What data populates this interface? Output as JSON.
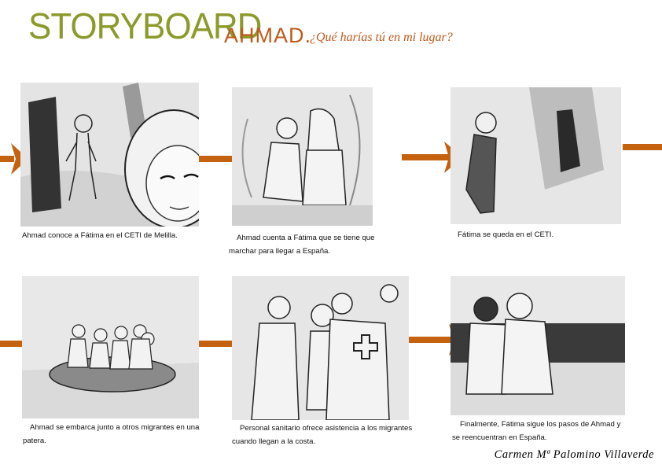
{
  "header": {
    "title": "STORYBOARD",
    "subtitle": "AHMAD.",
    "question": "¿Qué harías tú en mi lugar?"
  },
  "colors": {
    "title": "#8c9a2a",
    "accent": "#c05a1c",
    "arrow": "#c4620f"
  },
  "panels": [
    {
      "caption": "Ahmad conoce a Fátima en el CETI de Melilla."
    },
    {
      "caption": "Ahmad cuenta a Fátima que se tiene que marchar para llegar a España."
    },
    {
      "caption": "Fátima se queda en el CETI."
    },
    {
      "caption": "Ahmad se embarca junto a otros migrantes en una patera."
    },
    {
      "caption": "Personal sanitario ofrece asistencia a los migrantes cuando llegan a la costa."
    },
    {
      "caption": "Finalmente, Fátima sigue los pasos de Ahmad y se reencuentran en España."
    }
  ],
  "author": "Carmen Mª Palomino Villaverde"
}
